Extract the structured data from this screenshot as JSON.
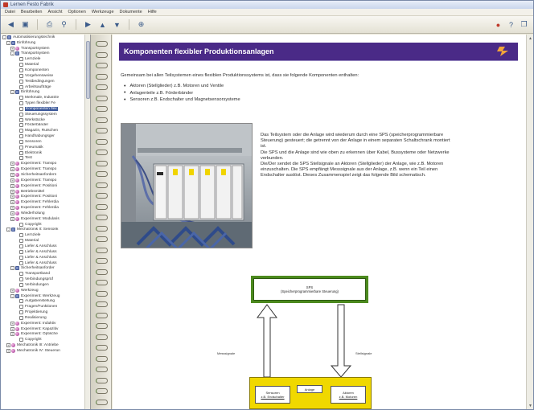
{
  "window": {
    "title": "Lernen Festo Fabrik"
  },
  "menu": [
    "Datei",
    "Bearbeiten",
    "Ansicht",
    "Optionen",
    "Werkzeuge",
    "Dokumente",
    "Hilfe"
  ],
  "toolbar": {
    "buttons": [
      "back-icon",
      "save-icon",
      "print-icon",
      "find-icon",
      "forward-icon",
      "up-icon",
      "down-icon",
      "zoom-icon",
      "home-icon"
    ]
  },
  "tree": [
    {
      "level": 0,
      "icon": "openbook",
      "exp": "-",
      "label": "Automatisierungstechnik"
    },
    {
      "level": 1,
      "icon": "openbook",
      "exp": "-",
      "label": "Einführung"
    },
    {
      "level": 2,
      "icon": "globe",
      "exp": "+",
      "label": "Transportsystem"
    },
    {
      "level": 2,
      "icon": "openbook",
      "exp": "-",
      "label": "Transportsystem"
    },
    {
      "level": 3,
      "icon": "page",
      "exp": "",
      "label": "Lernziele"
    },
    {
      "level": 3,
      "icon": "page",
      "exp": "",
      "label": "Material"
    },
    {
      "level": 3,
      "icon": "page",
      "exp": "",
      "label": "Komponenten"
    },
    {
      "level": 3,
      "icon": "page",
      "exp": "",
      "label": "Vorgehensweise"
    },
    {
      "level": 3,
      "icon": "page",
      "exp": "",
      "label": "Testbedingungen"
    },
    {
      "level": 3,
      "icon": "page",
      "exp": "",
      "label": "Arbeitsaufträge"
    },
    {
      "level": 2,
      "icon": "openbook",
      "exp": "-",
      "label": "Einführung"
    },
    {
      "level": 3,
      "icon": "page",
      "exp": "",
      "label": "Merkmale, Industrie"
    },
    {
      "level": 3,
      "icon": "page",
      "exp": "",
      "label": "Typen flexibler Fe"
    },
    {
      "level": 3,
      "icon": "page",
      "exp": "",
      "label": "Komponenten flex",
      "sel": true
    },
    {
      "level": 3,
      "icon": "page",
      "exp": "",
      "label": "Steuerungssystem"
    },
    {
      "level": 3,
      "icon": "page",
      "exp": "",
      "label": "Werkstücke"
    },
    {
      "level": 3,
      "icon": "page",
      "exp": "",
      "label": "Förderbänder"
    },
    {
      "level": 3,
      "icon": "page",
      "exp": "",
      "label": "Magazin, Rutschen"
    },
    {
      "level": 3,
      "icon": "page",
      "exp": "",
      "label": "Handhabungsger"
    },
    {
      "level": 3,
      "icon": "page",
      "exp": "",
      "label": "Sensoren"
    },
    {
      "level": 3,
      "icon": "page",
      "exp": "",
      "label": "Pneumatik"
    },
    {
      "level": 3,
      "icon": "page",
      "exp": "",
      "label": "Elektronik"
    },
    {
      "level": 3,
      "icon": "page",
      "exp": "",
      "label": "Test"
    },
    {
      "level": 2,
      "icon": "globe",
      "exp": "+",
      "label": "Experiment: Transpo"
    },
    {
      "level": 2,
      "icon": "globe",
      "exp": "+",
      "label": "Experiment: Transpo"
    },
    {
      "level": 2,
      "icon": "globe",
      "exp": "+",
      "label": "Sicherheitsanfordern"
    },
    {
      "level": 2,
      "icon": "globe",
      "exp": "+",
      "label": "Experiment: Transpo"
    },
    {
      "level": 2,
      "icon": "globe",
      "exp": "+",
      "label": "Experiment: Positioni"
    },
    {
      "level": 2,
      "icon": "globe",
      "exp": "+",
      "label": "Betriebsmittel"
    },
    {
      "level": 2,
      "icon": "globe",
      "exp": "+",
      "label": "Experiment: Positioni"
    },
    {
      "level": 2,
      "icon": "globe",
      "exp": "+",
      "label": "Experiment: Fehlerdia"
    },
    {
      "level": 2,
      "icon": "globe",
      "exp": "+",
      "label": "Experiment: Fehlerdia"
    },
    {
      "level": 2,
      "icon": "globe",
      "exp": "+",
      "label": "Wiederholung"
    },
    {
      "level": 2,
      "icon": "globe",
      "exp": "+",
      "label": "Experiment: Modularis"
    },
    {
      "level": 3,
      "icon": "page",
      "exp": "",
      "label": "Copyright"
    },
    {
      "level": 1,
      "icon": "openbook",
      "exp": "-",
      "label": "Mechatronik II: Sensorik"
    },
    {
      "level": 3,
      "icon": "page",
      "exp": "",
      "label": "Lernziele"
    },
    {
      "level": 3,
      "icon": "page",
      "exp": "",
      "label": "Material"
    },
    {
      "level": 3,
      "icon": "page",
      "exp": "",
      "label": "Liefer & Anschluss"
    },
    {
      "level": 3,
      "icon": "page",
      "exp": "",
      "label": "Liefer & Anschluss"
    },
    {
      "level": 3,
      "icon": "page",
      "exp": "",
      "label": "Liefer & Anschluss"
    },
    {
      "level": 3,
      "icon": "page",
      "exp": "",
      "label": "Liefer & Anschluss"
    },
    {
      "level": 2,
      "icon": "openbook",
      "exp": "-",
      "label": "Sicherheitsanforder"
    },
    {
      "level": 3,
      "icon": "page",
      "exp": "",
      "label": "Transportband"
    },
    {
      "level": 3,
      "icon": "page",
      "exp": "",
      "label": "Verbindungsprüf"
    },
    {
      "level": 3,
      "icon": "page",
      "exp": "",
      "label": "Verbindungen"
    },
    {
      "level": 2,
      "icon": "globe",
      "exp": "+",
      "label": "Werkzeug"
    },
    {
      "level": 2,
      "icon": "openbook",
      "exp": "-",
      "label": "Experiment: Werkzeug"
    },
    {
      "level": 3,
      "icon": "page",
      "exp": "",
      "label": "Aufgabenstellung"
    },
    {
      "level": 3,
      "icon": "page",
      "exp": "",
      "label": "Fragen/Funktionen"
    },
    {
      "level": 3,
      "icon": "page",
      "exp": "",
      "label": "Projektierung"
    },
    {
      "level": 3,
      "icon": "page",
      "exp": "",
      "label": "Realisierung"
    },
    {
      "level": 2,
      "icon": "globe",
      "exp": "+",
      "label": "Experiment: Induktiv"
    },
    {
      "level": 2,
      "icon": "globe",
      "exp": "+",
      "label": "Experiment: Kapazitiv"
    },
    {
      "level": 2,
      "icon": "globe",
      "exp": "+",
      "label": "Experiment: Optische"
    },
    {
      "level": 3,
      "icon": "page",
      "exp": "",
      "label": "Copyright"
    },
    {
      "level": 1,
      "icon": "globe",
      "exp": "+",
      "label": "Mechatronik III: Antriebe"
    },
    {
      "level": 1,
      "icon": "globe",
      "exp": "+",
      "label": "Mechatronik IV: Steuerun"
    }
  ],
  "content": {
    "heading": "Komponenten flexibler Produktionsanlagen",
    "logo_text": "FESTO",
    "intro": "Gemeinsam bei allen Teilsystemen eines flexiblen Produktionssystems ist, dass sie folgende Komponenten enthalten:",
    "bullets": [
      "Aktoren (Stellglieder) z.B. Motoren und Ventile",
      "Anlagenteile z.B. Förderbänder",
      "Sensoren z.B. Endschalter und Magnetsensorsysteme"
    ],
    "text": [
      "Das Teilsystem oder die Anlage wird wiederum durch eine SPS (speicherprogrammierbare",
      "Steuerung) gesteuert; die getrennt von der Anlage in einem separaten Schaltschrank montiert",
      "ist.",
      "Die SPS und die Anlage sind wie oben zu erkennen über Kabel, Bussysteme oder Netzwerke",
      "verbunden.",
      "Die/Der sendet die SPS Stellsignale an Aktoren (Stellglieder) der Anlage, wie z.B. Motoren",
      "einzuschalten. Die SPS empfängt Messsignale aus der Anlage, z.B. wenn ein Teil einen",
      "Endschalter auslöst. Dieses Zusammenspiel zeigt das folgende Bild schematisch."
    ],
    "diagram": {
      "sps_title": "SPS",
      "sps_subtitle": "(Speicherprogrammierbare Steuerung)",
      "left_label": "Messsignale",
      "right_label": "Stellsignale",
      "plant": [
        {
          "l1": "Sensoren",
          "l2": "z.B. Endschalter"
        },
        {
          "l1": "Anlage",
          "l2": ""
        },
        {
          "l1": "Aktoren",
          "l2": "z.B. Motoren"
        }
      ],
      "colors": {
        "sps": "#4c8a1e",
        "plant": "#f0d800"
      }
    }
  },
  "colors": {
    "banner": "#4a2a87",
    "selection": "#3d5a9b"
  }
}
